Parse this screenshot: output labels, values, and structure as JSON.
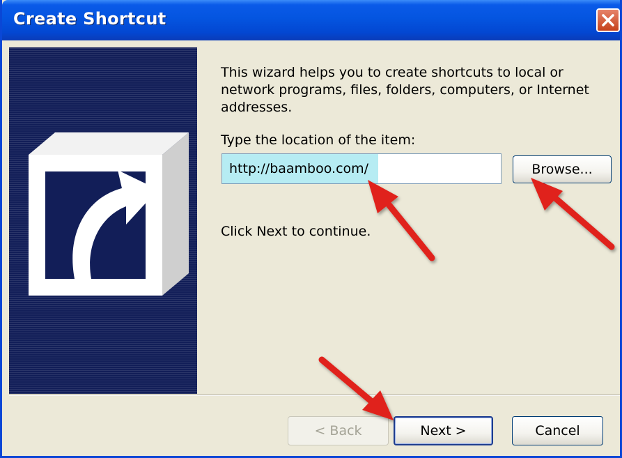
{
  "window": {
    "title": "Create Shortcut"
  },
  "content": {
    "intro": "This wizard helps you to create shortcuts to local or network programs, files, folders, computers, or Internet addresses.",
    "location_label": "Type the location of the item:",
    "location_value": "http://baamboo.com/",
    "browse_label": "Browse...",
    "continue_text": "Click Next to continue."
  },
  "footer": {
    "back_label": "< Back",
    "next_label": "Next >",
    "cancel_label": "Cancel"
  },
  "icons": {
    "close": "close-icon",
    "shortcut": "shortcut-arrow-icon",
    "annotation_arrow": "red-arrow"
  },
  "colors": {
    "titlebar": "#0455e0",
    "sidebar": "#121e58",
    "dialog_bg": "#ece9d8",
    "selection": "#b6ecf3",
    "annotation": "#e0201a"
  }
}
